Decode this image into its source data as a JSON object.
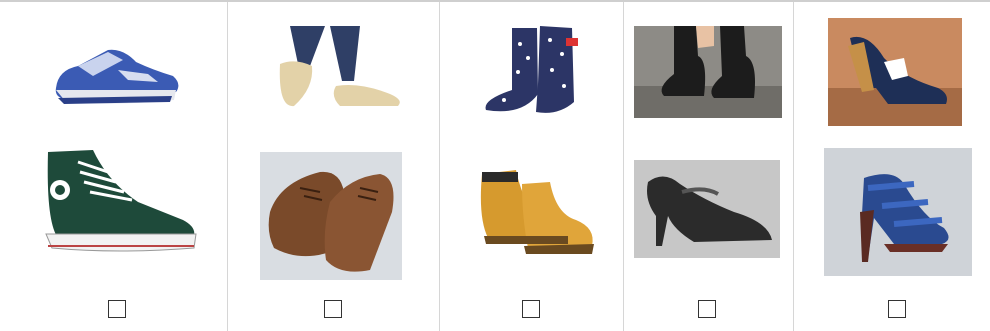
{
  "columns": [
    {
      "images": [
        {
          "label": "running-sneaker",
          "icon": "blue-running-shoe"
        },
        {
          "label": "high-top-sneaker",
          "icon": "green-high-top"
        }
      ],
      "checkbox_checked": false
    },
    {
      "images": [
        {
          "label": "ballet-flats",
          "icon": "beige-flats"
        },
        {
          "label": "oxford-shoes",
          "icon": "brown-oxfords"
        }
      ],
      "checkbox_checked": false
    },
    {
      "images": [
        {
          "label": "rain-boots",
          "icon": "polka-dot-wellies"
        },
        {
          "label": "work-boots",
          "icon": "tan-work-boots"
        }
      ],
      "checkbox_checked": false
    },
    {
      "images": [
        {
          "label": "ankle-boots",
          "icon": "black-ankle-boots"
        },
        {
          "label": "mary-jane-heels",
          "icon": "black-heels"
        }
      ],
      "checkbox_checked": false
    },
    {
      "images": [
        {
          "label": "wedge-sandals",
          "icon": "navy-wedges"
        },
        {
          "label": "strappy-heels",
          "icon": "blue-strappy-sandals"
        }
      ],
      "checkbox_checked": false
    }
  ],
  "colors": {
    "grid_line": "#d6d6d6",
    "top_border": "#cfcfcf",
    "checkbox_border": "#333333"
  }
}
